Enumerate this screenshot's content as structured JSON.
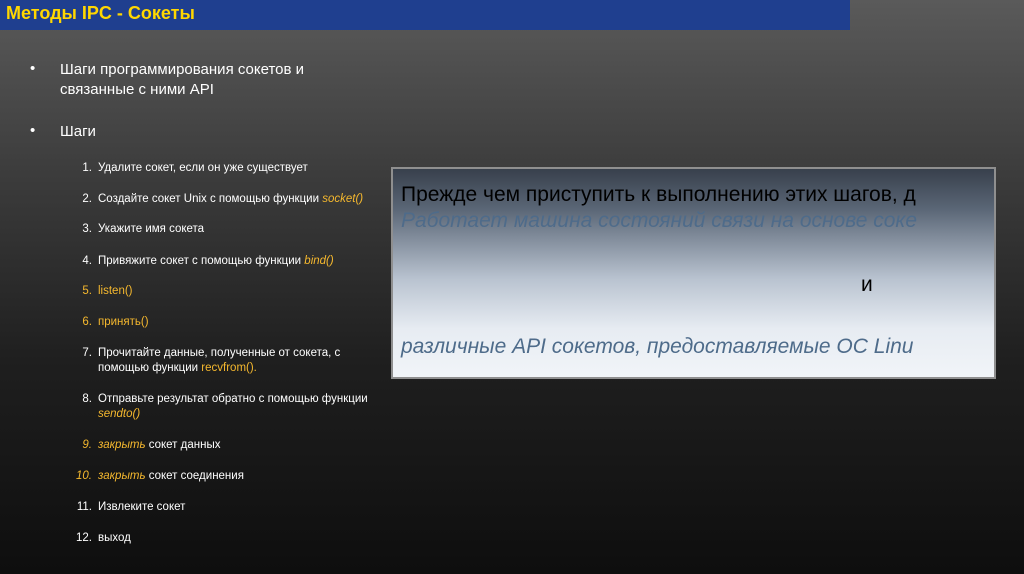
{
  "title": "Методы IPC - Сокеты",
  "bullets": [
    {
      "line1": "Шаги программирования сокетов и",
      "line2": "связанные с ними API"
    },
    {
      "line1": "Шаги"
    }
  ],
  "steps": [
    {
      "num": "1.",
      "parts": [
        "Удалите сокет, если он уже существует"
      ]
    },
    {
      "num": "2.",
      "parts": [
        "Создайте сокет Unix с помощью функции ",
        "socket()"
      ]
    },
    {
      "num": "3.",
      "parts": [
        "Укажите имя сокета"
      ]
    },
    {
      "num": "4.",
      "parts": [
        "Привяжите сокет с помощью функции ",
        "bind()"
      ]
    },
    {
      "num": "5.",
      "parts": [
        "listen()"
      ]
    },
    {
      "num": "6.",
      "parts": [
        "принять()"
      ]
    },
    {
      "num": "7.",
      "parts": [
        "Прочитайте данные, полученные от сокета, с",
        "помощью функции ",
        "recvfrom()."
      ]
    },
    {
      "num": "8.",
      "parts": [
        "Отправьте результат обратно с помощью функции",
        "sendto()"
      ]
    },
    {
      "num": "9.",
      "parts": [
        "закрыть",
        " сокет данных"
      ]
    },
    {
      "num": "10.",
      "parts": [
        "закрыть",
        " сокет соединения"
      ]
    },
    {
      "num": "11.",
      "parts": [
        "Извлеките сокет"
      ]
    },
    {
      "num": "12.",
      "parts": [
        "выход"
      ]
    }
  ],
  "overlay": {
    "line1": "Прежде чем приступить к выполнению этих шагов, д",
    "line2": "Работает машина состояний связи на основе соке",
    "and": "и",
    "line3": "различные API сокетов, предоставляемые ОС Linu"
  },
  "colors": {
    "title_bar": "#1f3f8f",
    "title_text": "#ffd700",
    "accent": "#f5b82e"
  }
}
